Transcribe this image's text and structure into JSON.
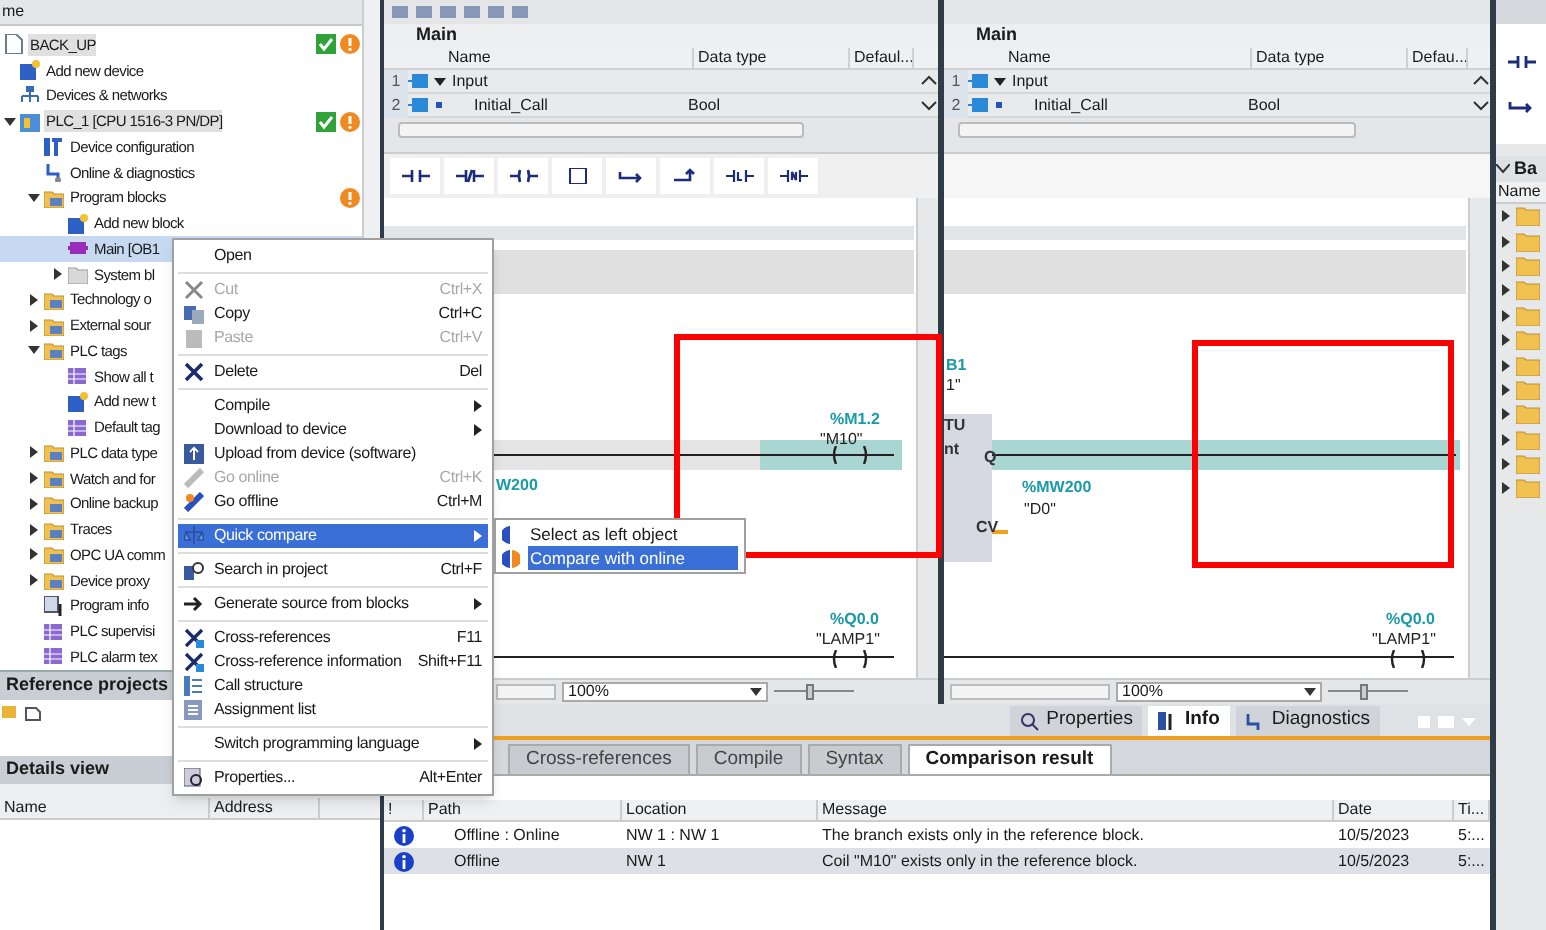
{
  "project_tree": {
    "header": "me",
    "items": [
      {
        "label": "BACK_UP",
        "kind": "project",
        "ok": true,
        "warning": true,
        "selected": false,
        "children": [
          {
            "label": "Add new device",
            "kind": "add",
            "ok": false,
            "warning": false,
            "selected": false
          },
          {
            "label": "Devices & networks",
            "kind": "network",
            "ok": false,
            "warning": false,
            "selected": false
          },
          {
            "label": "PLC_1 [CPU 1516-3 PN/DP]",
            "kind": "plc",
            "ok": true,
            "warning": true,
            "expanded": true,
            "selected": false,
            "children": [
              {
                "label": "Device configuration",
                "kind": "config",
                "ok": false,
                "warning": false,
                "selected": false
              },
              {
                "label": "Online & diagnostics",
                "kind": "diagnostics",
                "ok": false,
                "warning": false,
                "selected": false
              },
              {
                "label": "Program blocks",
                "kind": "folder",
                "ok": false,
                "warning": true,
                "expanded": true,
                "selected": false,
                "children": [
                  {
                    "label": "Add new block",
                    "kind": "add",
                    "ok": false,
                    "warning": false,
                    "selected": false
                  },
                  {
                    "label": "Main [OB1",
                    "kind": "block",
                    "selected": true
                  },
                  {
                    "label": "System bl",
                    "kind": "folder-gray",
                    "expanded": false,
                    "selected": false
                  }
                ]
              },
              {
                "label": "Technology o",
                "kind": "folder",
                "expanded": false,
                "selected": false
              },
              {
                "label": "External sour",
                "kind": "folder",
                "expanded": false,
                "selected": false
              },
              {
                "label": "PLC tags",
                "kind": "folder",
                "expanded": true,
                "selected": false,
                "children": [
                  {
                    "label": "Show all t",
                    "kind": "table",
                    "selected": false
                  },
                  {
                    "label": "Add new t",
                    "kind": "add",
                    "selected": false
                  },
                  {
                    "label": "Default tag",
                    "kind": "table",
                    "selected": false
                  }
                ]
              },
              {
                "label": "PLC data type",
                "kind": "folder",
                "expanded": false,
                "selected": false
              },
              {
                "label": "Watch and for",
                "kind": "folder",
                "expanded": false,
                "selected": false
              },
              {
                "label": "Online backup",
                "kind": "folder",
                "expanded": false,
                "selected": false
              },
              {
                "label": "Traces",
                "kind": "folder",
                "expanded": false,
                "selected": false
              },
              {
                "label": "OPC UA comm",
                "kind": "folder",
                "expanded": false,
                "selected": false
              },
              {
                "label": "Device proxy",
                "kind": "folder",
                "expanded": false,
                "selected": false
              },
              {
                "label": "Program info",
                "kind": "info",
                "selected": false
              },
              {
                "label": "PLC supervisi",
                "kind": "table",
                "selected": false
              },
              {
                "label": "PLC alarm tex",
                "kind": "table",
                "selected": false
              }
            ]
          }
        ]
      }
    ]
  },
  "reference_projects": {
    "title": "Reference projects"
  },
  "details_view": {
    "title": "Details view",
    "columns": [
      "Name",
      "Address"
    ]
  },
  "context_menu": {
    "groups": [
      [
        {
          "label": "Open",
          "disabled": false,
          "submenu": false,
          "selected": false
        }
      ],
      [
        {
          "label": "Cut",
          "shortcut": "Ctrl+X",
          "disabled": true,
          "submenu": false,
          "selected": false
        },
        {
          "label": "Copy",
          "shortcut": "Ctrl+C",
          "disabled": false,
          "submenu": false,
          "selected": false
        },
        {
          "label": "Paste",
          "shortcut": "Ctrl+V",
          "disabled": true,
          "submenu": false,
          "selected": false
        }
      ],
      [
        {
          "label": "Delete",
          "shortcut": "Del",
          "disabled": false,
          "submenu": false,
          "selected": false
        }
      ],
      [
        {
          "label": "Compile",
          "disabled": false,
          "submenu": true,
          "selected": false
        },
        {
          "label": "Download to device",
          "disabled": false,
          "submenu": true,
          "selected": false
        },
        {
          "label": "Upload from device (software)",
          "disabled": false,
          "submenu": false,
          "selected": false
        },
        {
          "label": "Go online",
          "shortcut": "Ctrl+K",
          "disabled": true,
          "submenu": false,
          "selected": false
        },
        {
          "label": "Go offline",
          "shortcut": "Ctrl+M",
          "disabled": false,
          "submenu": false,
          "selected": false
        }
      ],
      [
        {
          "label": "Quick compare",
          "disabled": false,
          "submenu": true,
          "selected": true
        }
      ],
      [
        {
          "label": "Search in project",
          "shortcut": "Ctrl+F",
          "disabled": false,
          "submenu": false,
          "selected": false
        }
      ],
      [
        {
          "label": "Generate source from blocks",
          "disabled": false,
          "submenu": true,
          "selected": false
        }
      ],
      [
        {
          "label": "Cross-references",
          "shortcut": "F11",
          "disabled": false,
          "submenu": false,
          "selected": false
        },
        {
          "label": "Cross-reference information",
          "shortcut": "Shift+F11",
          "disabled": false,
          "submenu": false,
          "selected": false
        },
        {
          "label": "Call structure",
          "disabled": false,
          "submenu": false,
          "selected": false
        },
        {
          "label": "Assignment list",
          "disabled": false,
          "submenu": false,
          "selected": false
        }
      ],
      [
        {
          "label": "Switch programming language",
          "disabled": false,
          "submenu": true,
          "selected": false
        }
      ],
      [
        {
          "label": "Properties...",
          "shortcut": "Alt+Enter",
          "disabled": false,
          "submenu": false,
          "selected": false
        }
      ]
    ],
    "submenu": [
      {
        "label": "Select as left object",
        "selected": false
      },
      {
        "label": "Compare with online",
        "selected": true
      }
    ]
  },
  "editors": [
    {
      "title": "Main",
      "columns": [
        "Name",
        "Data type",
        "Defaul..."
      ],
      "rows": [
        {
          "number": "1",
          "name": "Input",
          "expanded": true
        },
        {
          "number": "2",
          "name": "Initial_Call",
          "data_type": "Bool"
        }
      ],
      "labels": [
        "%M1.2",
        "\"M10\"",
        "W200",
        "%Q0.0",
        "\"LAMP1\""
      ],
      "zoom": "100%",
      "zoom_slider": {
        "level": 0.45
      }
    },
    {
      "title": "Main",
      "columns": [
        "Name",
        "Data type",
        "Defau..."
      ],
      "rows": [
        {
          "number": "1",
          "name": "Input",
          "expanded": true
        },
        {
          "number": "2",
          "name": "Initial_Call",
          "data_type": "Bool"
        }
      ],
      "labels": [
        "B1",
        "1\"",
        "TU",
        "nt",
        "Q",
        "CV",
        "%MW200",
        "\"D0\"",
        "%Q0.0",
        "\"LAMP1\""
      ],
      "zoom": "100%",
      "zoom_slider": {
        "level": 0.45
      }
    }
  ],
  "inspector": {
    "tabs": [
      {
        "label": "Properties",
        "selected": false
      },
      {
        "label": "Info",
        "selected": true
      },
      {
        "label": "Diagnostics",
        "selected": false
      }
    ],
    "subtabs": [
      {
        "label": "Cross-references",
        "selected": false
      },
      {
        "label": "Compile",
        "selected": false
      },
      {
        "label": "Syntax",
        "selected": false
      },
      {
        "label": "Comparison result",
        "selected": true
      }
    ],
    "columns": [
      "!",
      "Path",
      "Location",
      "Message",
      "Date",
      "Ti..."
    ],
    "rows": [
      {
        "path": "Offline : Online",
        "location": "NW 1 : NW 1",
        "message": "The branch exists only in the reference block.",
        "date": "10/5/2023",
        "time": "5:...",
        "selected": false
      },
      {
        "path": "Offline",
        "location": "NW 1",
        "message": "Coil \"M10\" exists only in the reference block.",
        "date": "10/5/2023",
        "time": "5:...",
        "selected": true
      }
    ]
  },
  "library": {
    "header": "Ba",
    "column": "Name"
  }
}
